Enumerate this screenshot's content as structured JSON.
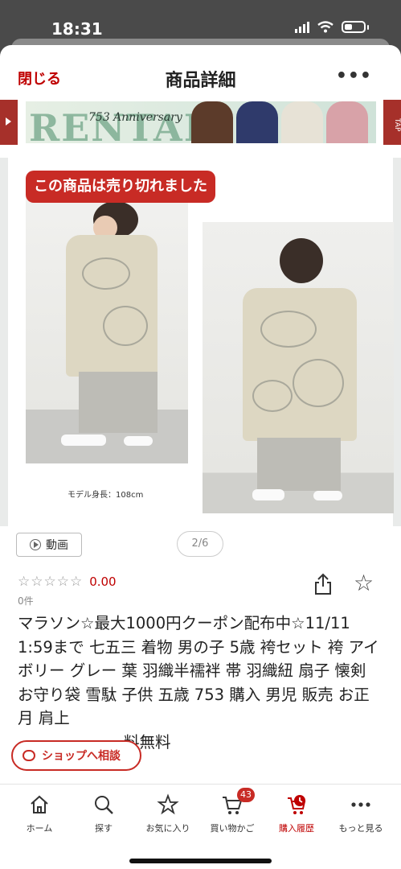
{
  "status": {
    "time": "18:31"
  },
  "header": {
    "close_label": "閉じる",
    "title": "商品詳細",
    "more_label": "•••"
  },
  "banner": {
    "rental_text": "RENTAL",
    "anniversary_text": "753 Anniversary",
    "right_tab_text": "TAP"
  },
  "gallery": {
    "soldout_label": "この商品は売り切れました",
    "model_height": "モデル身長：108cm"
  },
  "actions": {
    "video_label": "動画",
    "page_indicator": "2/6"
  },
  "rating": {
    "stars": "☆☆☆☆☆",
    "value": "0.00",
    "review_count": "0件"
  },
  "product": {
    "title": "マラソン☆最大1000円クーポン配布中☆11/11 1:59まで 七五三 着物 男の子 5歳 袴セット 袴 アイボリー グレー 葉 羽織半襦袢 帯 羽織紐 扇子 懐剣 お守り袋 雪駄 子供 五歳 753 購入 男児 販売 お正月 肩上",
    "title_tail": "料無料"
  },
  "shop_consult_label": "ショップへ相談",
  "tabbar": {
    "items": [
      {
        "label": "ホーム",
        "icon": "home-icon"
      },
      {
        "label": "探す",
        "icon": "search-icon"
      },
      {
        "label": "お気に入り",
        "icon": "star-icon"
      },
      {
        "label": "買い物かご",
        "icon": "cart-icon",
        "badge": "43"
      },
      {
        "label": "購入履歴",
        "icon": "purchase-history-icon",
        "active": true
      },
      {
        "label": "もっと見る",
        "icon": "more-icon"
      }
    ]
  },
  "colors": {
    "accent": "#bf0000",
    "soldout_bg": "#c82b25"
  }
}
